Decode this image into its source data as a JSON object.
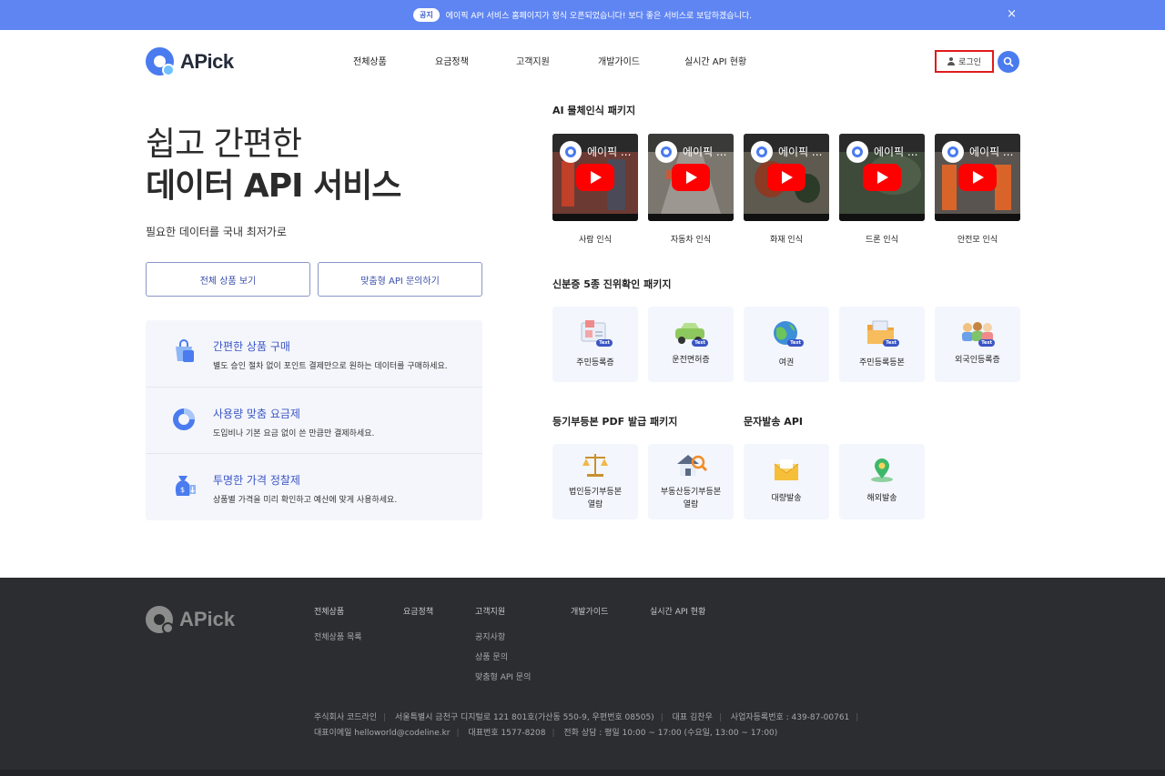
{
  "notice": {
    "tag": "공지",
    "text": "에이픽 API 서비스 홈페이지가 정식 오픈되었습니다! 보다 좋은 서비스로 보답하겠습니다.",
    "close": "×"
  },
  "header": {
    "logo_text": "APick",
    "nav": [
      "전체상품",
      "요금정책",
      "고객지원",
      "개발가이드",
      "실시간 API 현황"
    ],
    "login_label": "로그인"
  },
  "hero": {
    "line1": "쉽고 간편한",
    "line2": "데이터 API 서비스",
    "subtitle": "필요한 데이터를 국내 최저가로",
    "btn_all": "전체 상품 보기",
    "btn_custom": "맞춤형 API 문의하기"
  },
  "features": [
    {
      "title": "간편한 상품 구매",
      "desc": "별도 승인 절차 없이 포인트 결제만으로 원하는 데이터를 구매하세요.",
      "icon": "shopping-bag-icon"
    },
    {
      "title": "사용량 맞춤 요금제",
      "desc": "도입비나 기본 요금 없이 쓴 만큼만 결제하세요.",
      "icon": "pie-chart-icon"
    },
    {
      "title": "투명한 가격 정찰제",
      "desc": "상품별 가격을 미리 확인하고 예산에 맞게 사용하세요.",
      "icon": "money-bag-icon"
    }
  ],
  "packages": {
    "ai": {
      "title": "AI 물체인식 패키지",
      "video_title": "에이픽 ...",
      "items": [
        "사람 인식",
        "자동차 인식",
        "화재 인식",
        "드론 인식",
        "안전모 인식"
      ]
    },
    "id": {
      "title": "신분증 5종 진위확인 패키지",
      "badge": "Text",
      "items": [
        "주민등록증",
        "운전면허증",
        "여권",
        "주민등록등본",
        "외국인등록증"
      ]
    },
    "registry": {
      "title": "등기부등본 PDF 발급 패키지",
      "items": [
        "법인등기부등본\n열람",
        "부동산등기부등본\n열람"
      ]
    },
    "sms": {
      "title": "문자발송 API",
      "items": [
        "대량발송",
        "해외발송"
      ]
    }
  },
  "footer": {
    "logo_text": "APick",
    "columns": {
      "products": {
        "head": "전체상품",
        "links": [
          "전체상품 목록"
        ]
      },
      "pricing": {
        "head": "요금정책"
      },
      "support": {
        "head": "고객지원",
        "links": [
          "공지사항",
          "상품 문의",
          "맞춤형 API 문의"
        ]
      },
      "guide": {
        "head": "개발가이드"
      },
      "status": {
        "head": "실시간 API 현황"
      }
    },
    "info_line1": [
      "주식회사 코드라인",
      "서울특별시 금천구 디지털로 121 801호(가산동 550-9, 우편번호 08505)",
      "대표 김찬우",
      "사업자등록번호 : 439-87-00761"
    ],
    "info_line2": [
      "대표이메일 helloworld@codeline.kr",
      "대표번호 1577-8208",
      "전화 상담 : 평일 10:00 ~ 17:00 (수요일, 13:00 ~ 17:00)"
    ]
  },
  "colors": {
    "accent": "#4a7bef",
    "notice_bg": "#5f85f2",
    "footer_bg": "#2c2d31",
    "highlight": "#e01c1c"
  }
}
